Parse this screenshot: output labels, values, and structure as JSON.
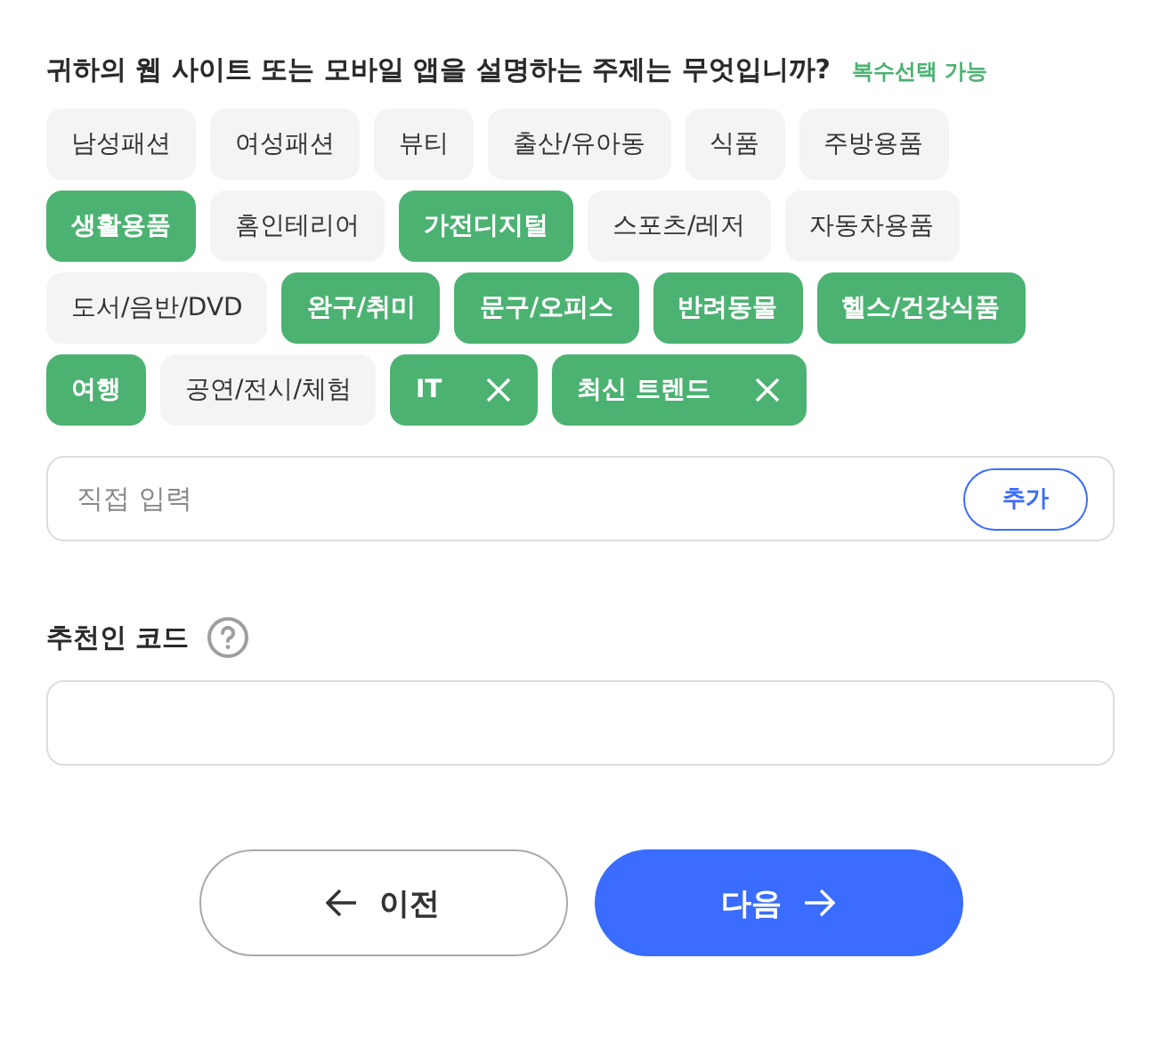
{
  "question": {
    "title": "귀하의 웹 사이트 또는 모바일 앱을 설명하는 주제는 무엇입니까?",
    "hint": "복수선택 가능"
  },
  "chips": [
    {
      "label": "남성패션",
      "kind": "preset",
      "selected": false
    },
    {
      "label": "여성패션",
      "kind": "preset",
      "selected": false
    },
    {
      "label": "뷰티",
      "kind": "preset",
      "selected": false
    },
    {
      "label": "출산/유아동",
      "kind": "preset",
      "selected": false
    },
    {
      "label": "식품",
      "kind": "preset",
      "selected": false
    },
    {
      "label": "주방용품",
      "kind": "preset",
      "selected": false
    },
    {
      "label": "생활용품",
      "kind": "preset",
      "selected": true
    },
    {
      "label": "홈인테리어",
      "kind": "preset",
      "selected": false
    },
    {
      "label": "가전디지털",
      "kind": "preset",
      "selected": true
    },
    {
      "label": "스포츠/레저",
      "kind": "preset",
      "selected": false
    },
    {
      "label": "자동차용품",
      "kind": "preset",
      "selected": false
    },
    {
      "label": "도서/음반/DVD",
      "kind": "preset",
      "selected": false
    },
    {
      "label": "완구/취미",
      "kind": "preset",
      "selected": true
    },
    {
      "label": "문구/오피스",
      "kind": "preset",
      "selected": true
    },
    {
      "label": "반려동물",
      "kind": "preset",
      "selected": true
    },
    {
      "label": "헬스/건강식품",
      "kind": "preset",
      "selected": true
    },
    {
      "label": "여행",
      "kind": "preset",
      "selected": true
    },
    {
      "label": "공연/전시/체험",
      "kind": "preset",
      "selected": false
    },
    {
      "label": "IT",
      "kind": "custom",
      "selected": true
    },
    {
      "label": "최신 트렌드",
      "kind": "custom",
      "selected": true
    }
  ],
  "custom_input": {
    "placeholder": "직접 입력",
    "button": "추가"
  },
  "referral": {
    "label": "추천인 코드"
  },
  "buttons": {
    "prev": "이전",
    "next": "다음"
  }
}
